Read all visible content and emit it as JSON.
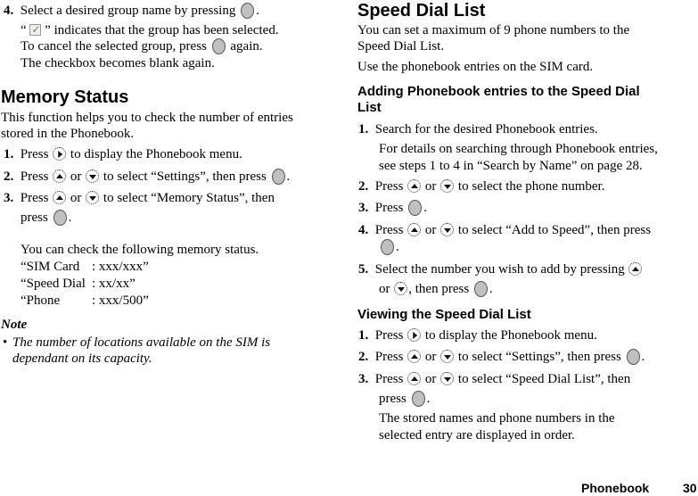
{
  "left": {
    "step4": {
      "num": "4.",
      "text_a": "Select a desired group name by pressing",
      "text_b": "."
    },
    "step4_note1_a": "“",
    "step4_note1_b": "” indicates that the group has been selected.",
    "step4_note2_a": "To cancel the selected group, press",
    "step4_note2_b": "again.",
    "step4_note3": "The checkbox becomes blank again.",
    "memory_title": "Memory Status",
    "memory_intro_1": "This function helps you to check the number of entries",
    "memory_intro_2": "stored in the Phonebook.",
    "steps": [
      {
        "num": "1.",
        "a": "Press",
        "b": "to display the Phonebook menu."
      },
      {
        "num": "2.",
        "a": "Press",
        "or": "or",
        "b": "to select “Settings”, then press",
        "c": "."
      },
      {
        "num": "3.",
        "a": "Press",
        "or": "or",
        "b": "to select “Memory Status”, then",
        "c1": "press",
        "c": "."
      }
    ],
    "status_intro": "You can check the following memory status.",
    "status_rows": [
      {
        "label": "“SIM Card",
        "value": ": xxx/xxx”"
      },
      {
        "label": "“Speed Dial",
        "value": ": xx/xx”"
      },
      {
        "label": "“Phone",
        "value": ": xxx/500”"
      }
    ],
    "note_title": "Note",
    "note_bullet": "•",
    "note_1": "The number of locations available on the SIM is",
    "note_2": "dependant on its capacity."
  },
  "right": {
    "title": "Speed Dial List",
    "intro_1": "You can set a maximum of 9 phone numbers to the",
    "intro_2": "Speed Dial List.",
    "intro_3": "Use the phonebook entries on the SIM card.",
    "add_title_1": "Adding Phonebook entries to the Speed Dial",
    "add_title_2": "List",
    "add_steps": {
      "s1": {
        "num": "1.",
        "text": "Search for the desired Phonebook entries.",
        "sub1": "For details on searching through Phonebook entries,",
        "sub2": "see steps 1 to 4 in “Search by Name” on page 28."
      },
      "s2": {
        "num": "2.",
        "a": "Press",
        "or": "or",
        "b": "to select the phone number."
      },
      "s3": {
        "num": "3.",
        "a": "Press",
        "c": "."
      },
      "s4": {
        "num": "4.",
        "a": "Press",
        "or": "or",
        "b": "to select “Add to Speed”, then press",
        "c": "."
      },
      "s5": {
        "num": "5.",
        "a": "Select the number you wish to add by pressing",
        "or": "or",
        "b": ", then press",
        "c": "."
      }
    },
    "view_title": "Viewing the Speed Dial List",
    "view_steps": {
      "s1": {
        "num": "1.",
        "a": "Press",
        "b": "to display the Phonebook menu."
      },
      "s2": {
        "num": "2.",
        "a": "Press",
        "or": "or",
        "b": "to select “Settings”, then press",
        "c": "."
      },
      "s3": {
        "num": "3.",
        "a": "Press",
        "or": "or",
        "b": "to select “Speed Dial List”, then",
        "c1": "press",
        "c": ".",
        "sub1": "The stored names and phone numbers in the",
        "sub2": "selected entry are displayed in order."
      }
    }
  },
  "footer": {
    "section": "Phonebook",
    "page": "30"
  }
}
